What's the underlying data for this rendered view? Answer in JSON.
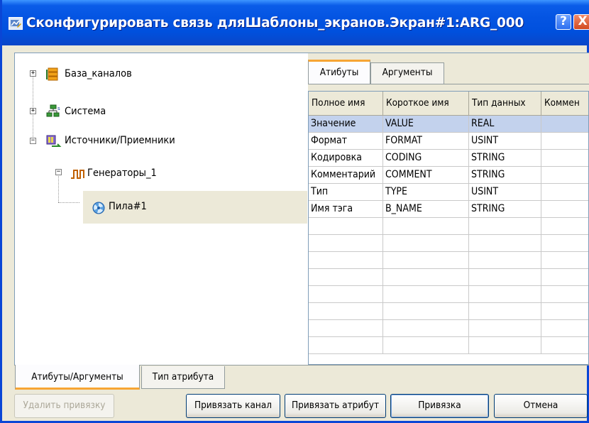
{
  "window": {
    "title": "Сконфигурировать связь дляШаблоны_экранов.Экран#1:ARG_000",
    "help_label": "?",
    "close_label": "X"
  },
  "tree": {
    "items": [
      {
        "label": "База_каналов",
        "expander": "+",
        "icon": "database-icon"
      },
      {
        "label": "Система",
        "expander": "+",
        "icon": "network-icon"
      },
      {
        "label": "Источники/Приемники",
        "expander": "−",
        "icon": "source-icon"
      },
      {
        "label": "Генераторы_1",
        "expander": "−",
        "icon": "pulse-icon"
      },
      {
        "label": "Пила#1",
        "icon": "fan-icon",
        "selected": true
      }
    ]
  },
  "inner_tabs": [
    {
      "label": "Атибуты",
      "active": true
    },
    {
      "label": "Аргументы",
      "active": false
    }
  ],
  "grid": {
    "columns": [
      "Полное имя",
      "Короткое имя",
      "Тип данных",
      "Коммен"
    ],
    "rows": [
      [
        "Значение",
        "VALUE",
        "REAL",
        ""
      ],
      [
        "Формат",
        "FORMAT",
        "USINT",
        ""
      ],
      [
        "Кодировка",
        "CODING",
        "STRING",
        ""
      ],
      [
        "Комментарий",
        "COMMENT",
        "STRING",
        ""
      ],
      [
        "Тип",
        "TYPE",
        "USINT",
        ""
      ],
      [
        "Имя тэга",
        "B_NAME",
        "STRING",
        ""
      ]
    ],
    "selected_row": 0
  },
  "bottom_tabs": [
    {
      "label": "Атибуты/Аргументы",
      "active": true
    },
    {
      "label": "Тип атрибута",
      "active": false
    }
  ],
  "buttons": {
    "unbind": "Удалить привязку",
    "bind_channel": "Привязать канал",
    "bind_attribute": "Привязать атрибут",
    "binding": "Привязка",
    "cancel": "Отмена"
  }
}
